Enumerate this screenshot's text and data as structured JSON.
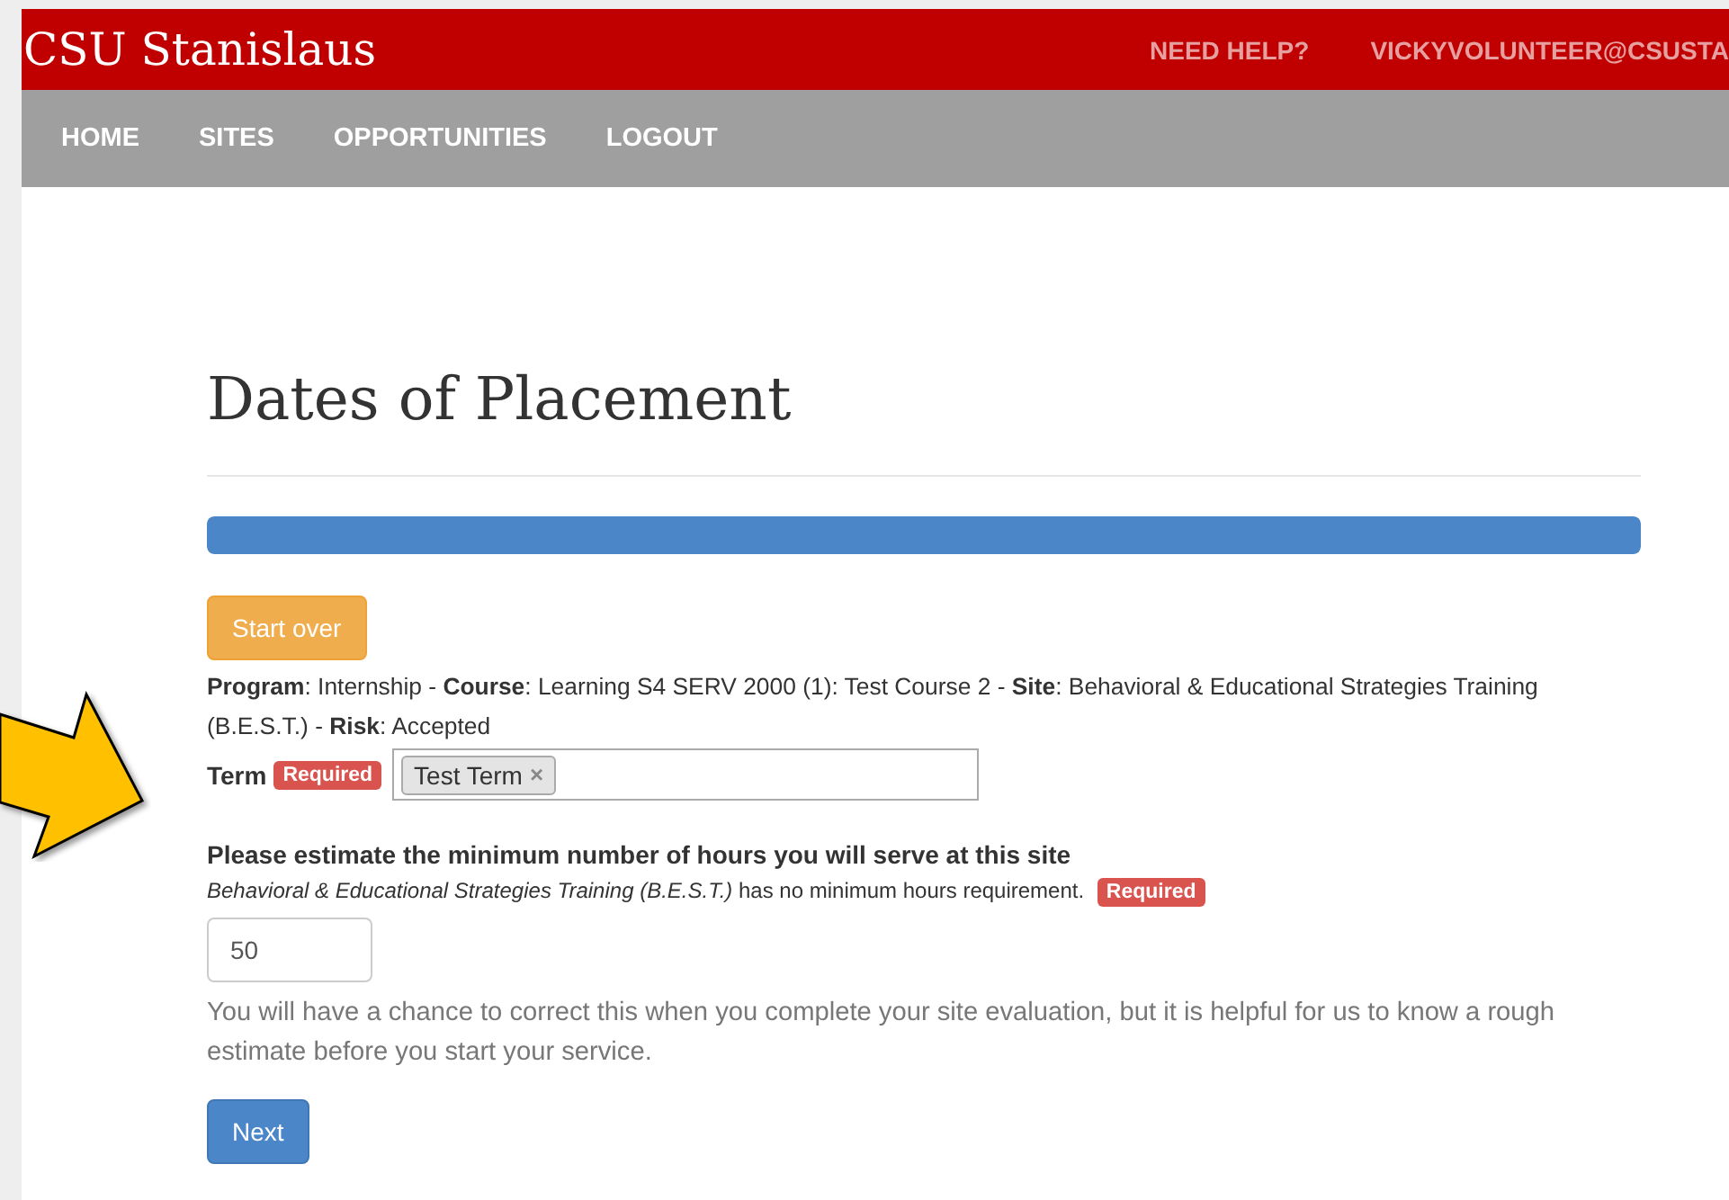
{
  "header": {
    "brand": "CSU Stanislaus",
    "links": [
      "NEED HELP?",
      "VICKYVOLUNTEER@CSUSTA"
    ]
  },
  "nav": {
    "items": [
      {
        "label": "HOME"
      },
      {
        "label": "SITES"
      },
      {
        "label": "OPPORTUNITIES"
      },
      {
        "label": "LOGOUT"
      }
    ]
  },
  "page": {
    "title": "Dates of Placement",
    "progress": {
      "level": 1
    },
    "start_over": "Start over",
    "summary": "**Program**: Internship - **Course**: Learning S4 SERV 2000 (1): Test Course 2 - **Site**: Behavioral & Educational Strategies Training (B.E.S.T.) - **Risk**: Accepted",
    "term": {
      "label": "Term",
      "badge": "Required",
      "tags": [
        {
          "label": "Test Term",
          "remove": "×"
        }
      ]
    },
    "hours": {
      "question": "Please estimate the minimum number of hours you will serve at this site",
      "note": "*Behavioral & Educational Strategies Training (B.E.S.T.)* has no minimum hours requirement.",
      "badge": "Required",
      "value": "50",
      "help": "You will have a chance to correct this when you complete your site evaluation, but it is helpful for us to know a rough estimate before you start your service."
    },
    "next": "Next"
  }
}
